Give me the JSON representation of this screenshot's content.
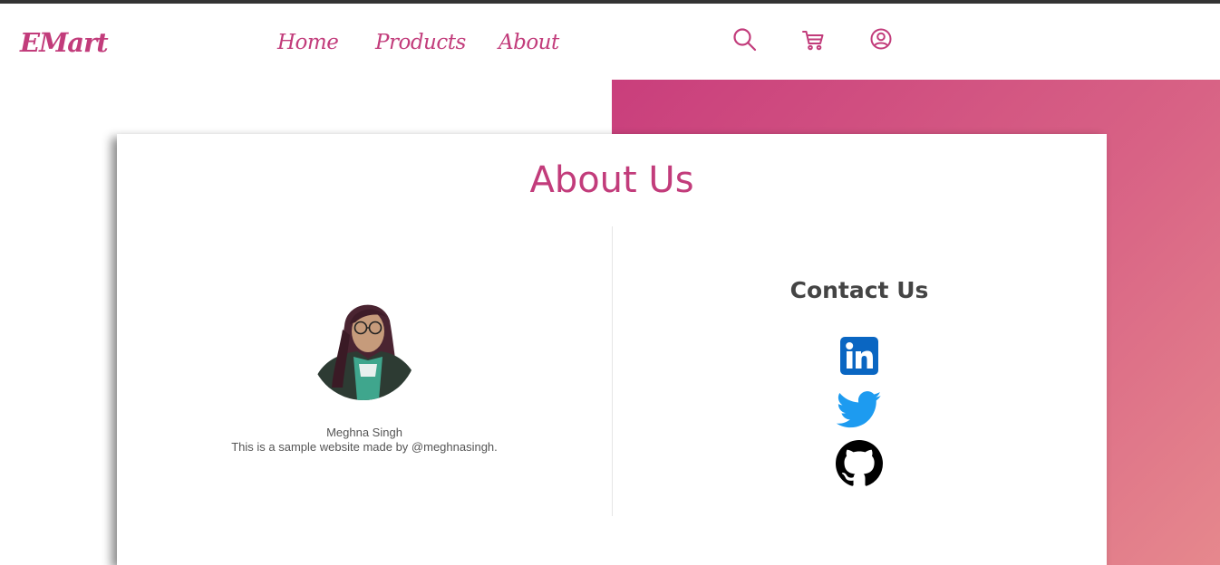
{
  "nav": {
    "brand": "EMart",
    "links": [
      {
        "label": "Home"
      },
      {
        "label": "Products"
      },
      {
        "label": "About"
      }
    ],
    "icons": [
      "search-icon",
      "cart-icon",
      "user-icon"
    ]
  },
  "colors": {
    "accent": "#c23c7b",
    "gradient_start": "#c93e7c",
    "gradient_end": "#e6888d",
    "linkedin": "#0a66c2",
    "twitter": "#1d9bf0",
    "github": "#000000"
  },
  "about": {
    "title": "About Us",
    "person": {
      "name": "Meghna Singh",
      "description": "This is a sample website made by @meghnasingh."
    },
    "contact": {
      "title": "Contact Us",
      "socials": [
        "linkedin-icon",
        "twitter-icon",
        "github-icon"
      ]
    }
  }
}
